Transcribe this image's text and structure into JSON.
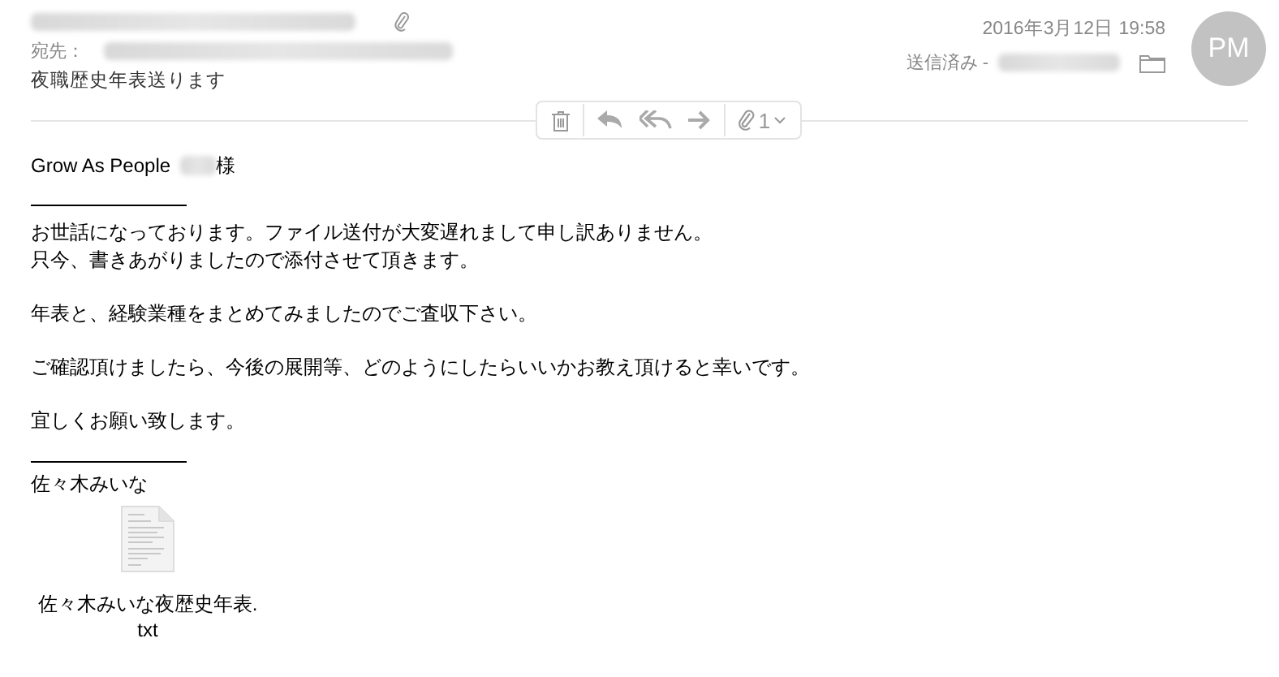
{
  "header": {
    "to_label": "宛先：",
    "subject": "夜職歴史年表送ります",
    "date": "2016年3月12日 19:58",
    "mailbox": "送信済み -",
    "avatar": "PM"
  },
  "toolbar": {
    "attachment_count": "1"
  },
  "body": {
    "greeting_prefix": "Grow As People",
    "greeting_suffix": "様",
    "paragraphs": [
      [
        "お世話になっております。ファイル送付が大変遅れまして申し訳ありません。",
        "只今、書きあがりましたので添付させて頂きます。"
      ],
      [
        "年表と、経験業種をまとめてみましたのでご査収下さい。"
      ],
      [
        "ご確認頂けましたら、今後の展開等、どのようにしたらいいかお教え頂けると幸いです。"
      ],
      [
        "宜しくお願い致します。"
      ]
    ],
    "signature": "佐々木みいな"
  },
  "attachment": {
    "filename": "佐々木みいな夜歴史年表.txt"
  }
}
